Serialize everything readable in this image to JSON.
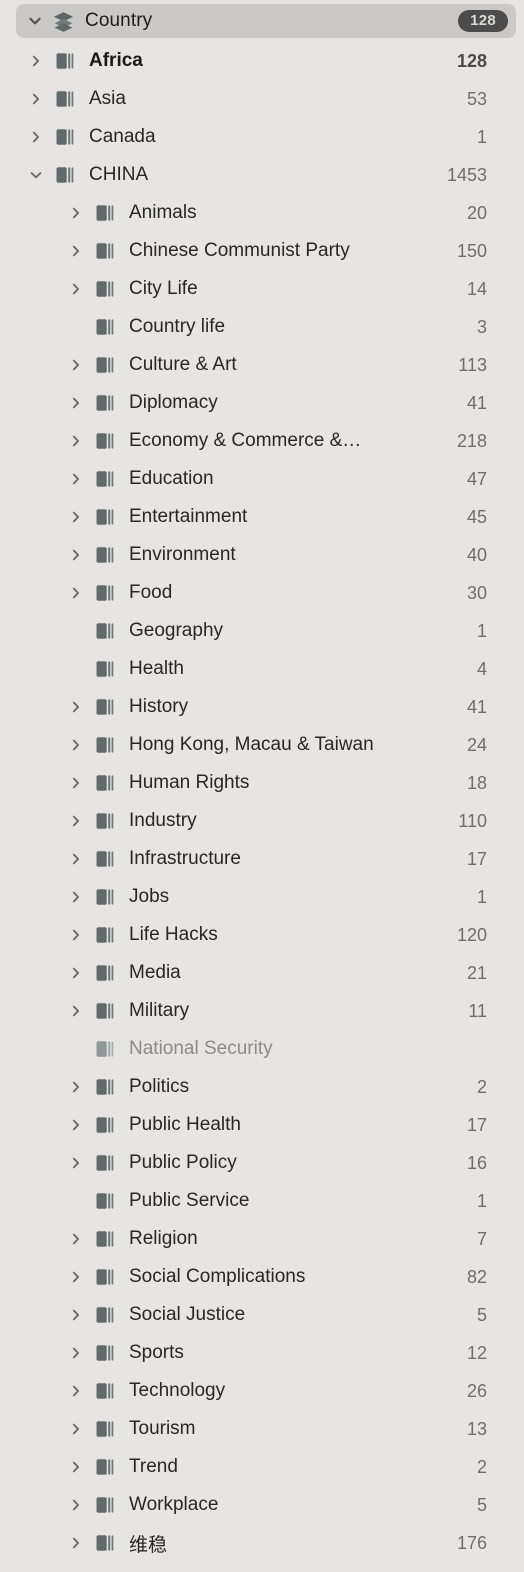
{
  "panel": {
    "name": "country-tag-tree"
  },
  "header": {
    "title": "Country",
    "badge": "128",
    "expanded": true,
    "icon": "layers-icon",
    "twisty_icon": "chevron-down-icon"
  },
  "icons": {
    "collapsed": "chevron-right-icon",
    "expanded": "chevron-down-icon",
    "row": "books-stack-icon"
  },
  "colors": {
    "panel_background": "#e6e5e3",
    "header_background": "#cac9c7",
    "badge_background": "#4c4c4c",
    "badge_text": "#dcdcda",
    "label_text": "#272727",
    "count_text": "#6e6e6e",
    "dim_text": "#8b8b8b",
    "icon_fill": "#616a6a",
    "icon_fill_dim": "#8e9898"
  },
  "rows": [
    {
      "label": "Africa",
      "count": "128",
      "level": 1,
      "twisty": "chevron-right-icon",
      "state": "bold"
    },
    {
      "label": "Asia",
      "count": "53",
      "level": 1,
      "twisty": "chevron-right-icon",
      "state": "normal"
    },
    {
      "label": "Canada",
      "count": "1",
      "level": 1,
      "twisty": "chevron-right-icon",
      "state": "normal"
    },
    {
      "label": "CHINA",
      "count": "1453",
      "level": 1,
      "twisty": "chevron-down-icon",
      "state": "normal"
    },
    {
      "label": "Animals",
      "count": "20",
      "level": 2,
      "twisty": "chevron-right-icon",
      "state": "normal"
    },
    {
      "label": "Chinese Communist Party",
      "count": "150",
      "level": 2,
      "twisty": "chevron-right-icon",
      "state": "normal"
    },
    {
      "label": "City Life",
      "count": "14",
      "level": 2,
      "twisty": "chevron-right-icon",
      "state": "normal"
    },
    {
      "label": "Country life",
      "count": "3",
      "level": 2,
      "twisty": "none",
      "state": "normal"
    },
    {
      "label": "Culture & Art",
      "count": "113",
      "level": 2,
      "twisty": "chevron-right-icon",
      "state": "normal"
    },
    {
      "label": "Diplomacy",
      "count": "41",
      "level": 2,
      "twisty": "chevron-right-icon",
      "state": "normal"
    },
    {
      "label": "Economy & Commerce &…",
      "count": "218",
      "level": 2,
      "twisty": "chevron-right-icon",
      "state": "normal"
    },
    {
      "label": "Education",
      "count": "47",
      "level": 2,
      "twisty": "chevron-right-icon",
      "state": "normal"
    },
    {
      "label": "Entertainment",
      "count": "45",
      "level": 2,
      "twisty": "chevron-right-icon",
      "state": "normal"
    },
    {
      "label": "Environment",
      "count": "40",
      "level": 2,
      "twisty": "chevron-right-icon",
      "state": "normal"
    },
    {
      "label": "Food",
      "count": "30",
      "level": 2,
      "twisty": "chevron-right-icon",
      "state": "normal"
    },
    {
      "label": "Geography",
      "count": "1",
      "level": 2,
      "twisty": "none",
      "state": "normal"
    },
    {
      "label": "Health",
      "count": "4",
      "level": 2,
      "twisty": "none",
      "state": "normal"
    },
    {
      "label": "History",
      "count": "41",
      "level": 2,
      "twisty": "chevron-right-icon",
      "state": "normal"
    },
    {
      "label": "Hong Kong, Macau & Taiwan",
      "count": "24",
      "level": 2,
      "twisty": "chevron-right-icon",
      "state": "normal"
    },
    {
      "label": "Human Rights",
      "count": "18",
      "level": 2,
      "twisty": "chevron-right-icon",
      "state": "normal"
    },
    {
      "label": "Industry",
      "count": "110",
      "level": 2,
      "twisty": "chevron-right-icon",
      "state": "normal"
    },
    {
      "label": "Infrastructure",
      "count": "17",
      "level": 2,
      "twisty": "chevron-right-icon",
      "state": "normal"
    },
    {
      "label": "Jobs",
      "count": "1",
      "level": 2,
      "twisty": "chevron-right-icon",
      "state": "normal"
    },
    {
      "label": "Life Hacks",
      "count": "120",
      "level": 2,
      "twisty": "chevron-right-icon",
      "state": "normal"
    },
    {
      "label": "Media",
      "count": "21",
      "level": 2,
      "twisty": "chevron-right-icon",
      "state": "normal"
    },
    {
      "label": "Military",
      "count": "11",
      "level": 2,
      "twisty": "chevron-right-icon",
      "state": "normal"
    },
    {
      "label": "National Security",
      "count": "",
      "level": 2,
      "twisty": "none",
      "state": "dim"
    },
    {
      "label": "Politics",
      "count": "2",
      "level": 2,
      "twisty": "chevron-right-icon",
      "state": "normal"
    },
    {
      "label": "Public Health",
      "count": "17",
      "level": 2,
      "twisty": "chevron-right-icon",
      "state": "normal"
    },
    {
      "label": "Public Policy",
      "count": "16",
      "level": 2,
      "twisty": "chevron-right-icon",
      "state": "normal"
    },
    {
      "label": "Public Service",
      "count": "1",
      "level": 2,
      "twisty": "none",
      "state": "normal"
    },
    {
      "label": "Religion",
      "count": "7",
      "level": 2,
      "twisty": "chevron-right-icon",
      "state": "normal"
    },
    {
      "label": "Social Complications",
      "count": "82",
      "level": 2,
      "twisty": "chevron-right-icon",
      "state": "normal"
    },
    {
      "label": "Social Justice",
      "count": "5",
      "level": 2,
      "twisty": "chevron-right-icon",
      "state": "normal"
    },
    {
      "label": "Sports",
      "count": "12",
      "level": 2,
      "twisty": "chevron-right-icon",
      "state": "normal"
    },
    {
      "label": "Technology",
      "count": "26",
      "level": 2,
      "twisty": "chevron-right-icon",
      "state": "normal"
    },
    {
      "label": "Tourism",
      "count": "13",
      "level": 2,
      "twisty": "chevron-right-icon",
      "state": "normal"
    },
    {
      "label": "Trend",
      "count": "2",
      "level": 2,
      "twisty": "chevron-right-icon",
      "state": "normal"
    },
    {
      "label": "Workplace",
      "count": "5",
      "level": 2,
      "twisty": "chevron-right-icon",
      "state": "normal"
    },
    {
      "label": "维稳",
      "count": "176",
      "level": 2,
      "twisty": "chevron-right-icon",
      "state": "normal"
    }
  ]
}
